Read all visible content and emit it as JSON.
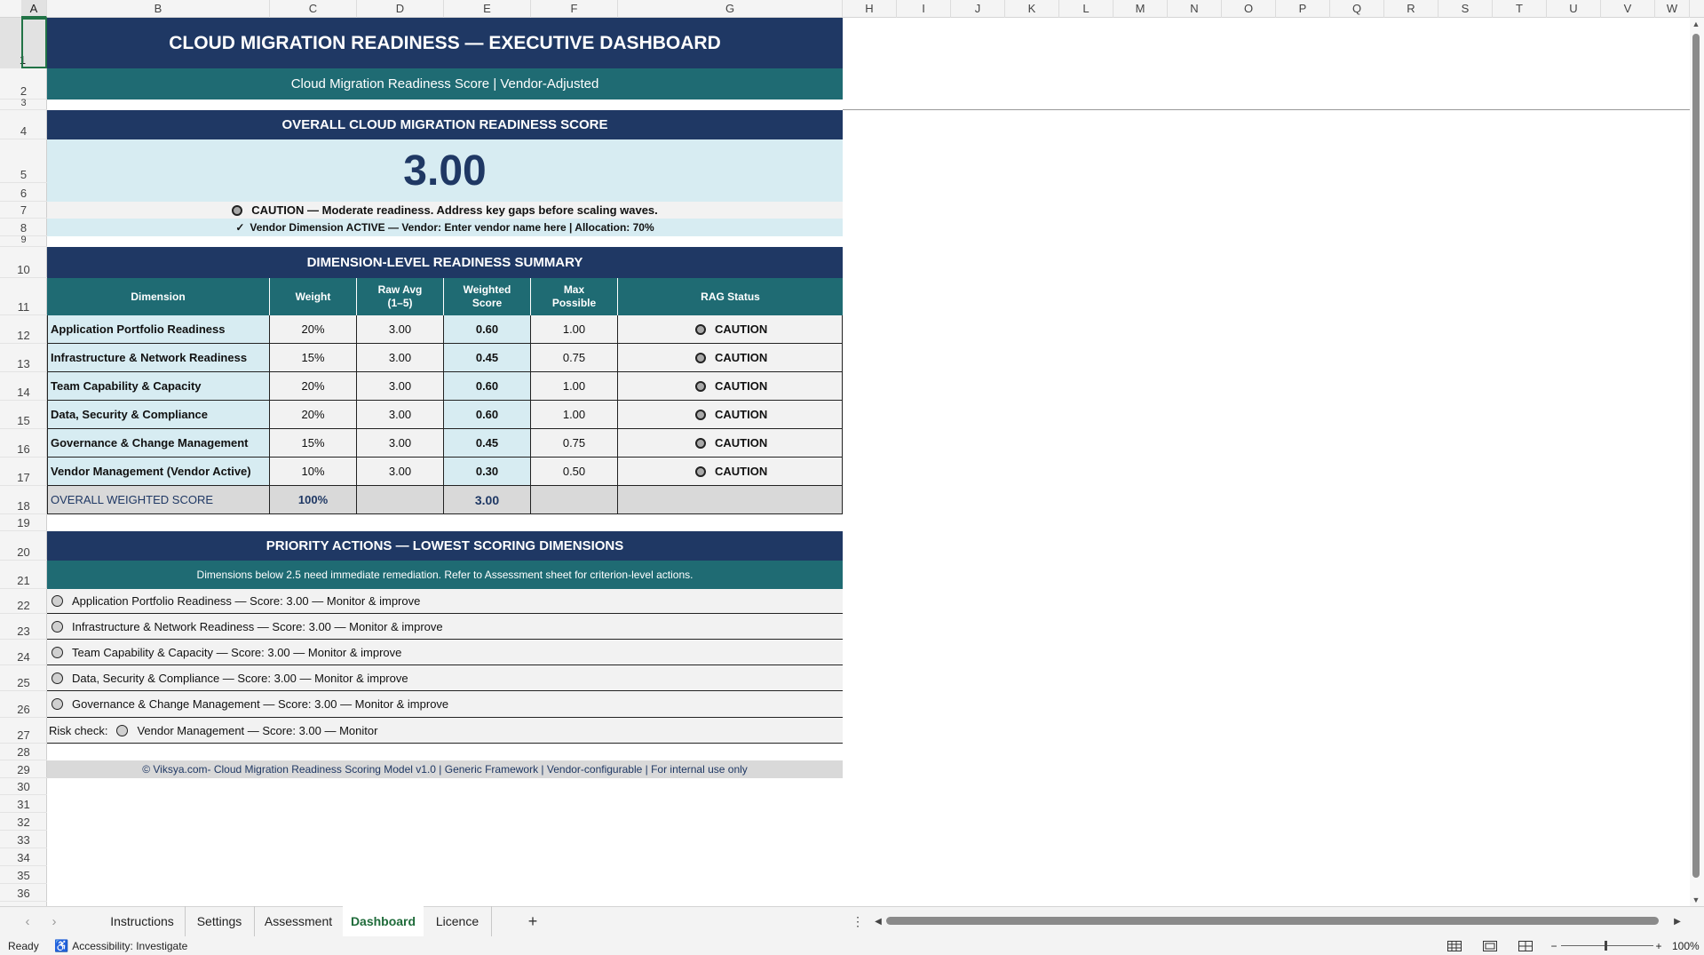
{
  "sheet": {
    "columns": [
      "A",
      "B",
      "C",
      "D",
      "E",
      "F",
      "G",
      "H",
      "I",
      "J",
      "K",
      "L",
      "M",
      "N",
      "O",
      "P",
      "Q",
      "R",
      "S",
      "T",
      "U",
      "V",
      "W"
    ],
    "rows": [
      "1",
      "2",
      "3",
      "4",
      "5",
      "6",
      "7",
      "8",
      "9",
      "10",
      "11",
      "12",
      "13",
      "14",
      "15",
      "16",
      "17",
      "18",
      "19",
      "20",
      "21",
      "22",
      "23",
      "24",
      "25",
      "26",
      "27",
      "28",
      "29",
      "30",
      "31",
      "32",
      "33",
      "34",
      "35",
      "36"
    ],
    "selected_cell": "A1"
  },
  "dashboard": {
    "title": "CLOUD MIGRATION READINESS — EXECUTIVE DASHBOARD",
    "subtitle": "Cloud Migration Readiness Score  |  Vendor-Adjusted",
    "overall_header": "OVERALL CLOUD MIGRATION READINESS SCORE",
    "overall_score": "3.00",
    "caution_text": "CAUTION — Moderate readiness. Address key gaps before scaling waves.",
    "vendor_check": "✓",
    "vendor_text": "Vendor Dimension ACTIVE — Vendor: Enter vendor name here  |  Allocation: 70%",
    "summary_header": "DIMENSION-LEVEL READINESS SUMMARY",
    "table": {
      "headers": {
        "dimension": "Dimension",
        "weight": "Weight",
        "raw_avg": "Raw Avg\n(1–5)",
        "weighted": "Weighted\nScore",
        "max": "Max\nPossible",
        "rag": "RAG Status"
      },
      "rows": [
        {
          "dimension": "Application Portfolio Readiness",
          "weight": "20%",
          "raw": "3.00",
          "weighted": "0.60",
          "max": "1.00",
          "rag": "CAUTION"
        },
        {
          "dimension": "Infrastructure & Network Readiness",
          "weight": "15%",
          "raw": "3.00",
          "weighted": "0.45",
          "max": "0.75",
          "rag": "CAUTION"
        },
        {
          "dimension": "Team Capability & Capacity",
          "weight": "20%",
          "raw": "3.00",
          "weighted": "0.60",
          "max": "1.00",
          "rag": "CAUTION"
        },
        {
          "dimension": "Data, Security & Compliance",
          "weight": "20%",
          "raw": "3.00",
          "weighted": "0.60",
          "max": "1.00",
          "rag": "CAUTION"
        },
        {
          "dimension": "Governance & Change Management",
          "weight": "15%",
          "raw": "3.00",
          "weighted": "0.45",
          "max": "0.75",
          "rag": "CAUTION"
        },
        {
          "dimension": "Vendor Management (Vendor Active)",
          "weight": "10%",
          "raw": "3.00",
          "weighted": "0.30",
          "max": "0.50",
          "rag": "CAUTION"
        }
      ],
      "total": {
        "label": "OVERALL WEIGHTED SCORE",
        "weight": "100%",
        "weighted": "3.00"
      }
    },
    "priority_header": "PRIORITY ACTIONS — LOWEST SCORING DIMENSIONS",
    "priority_note": "Dimensions below 2.5 need immediate remediation. Refer to Assessment sheet for criterion-level actions.",
    "priority_items": [
      "Application Portfolio Readiness — Score: 3.00 — Monitor & improve",
      "Infrastructure & Network Readiness — Score: 3.00 — Monitor & improve",
      "Team Capability & Capacity — Score: 3.00 — Monitor & improve",
      "Data, Security & Compliance — Score: 3.00 — Monitor & improve",
      "Governance & Change Management — Score: 3.00 — Monitor & improve"
    ],
    "risk_label": "Risk check:",
    "risk_text": "Vendor Management — Score: 3.00 — Monitor",
    "footer": "© Viksya.com- Cloud Migration Readiness Scoring Model v1.0  |  Generic Framework  |  Vendor-configurable  |  For internal use only"
  },
  "tabs": [
    {
      "label": "Instructions",
      "active": false
    },
    {
      "label": "Settings",
      "active": false
    },
    {
      "label": "Assessment",
      "active": false
    },
    {
      "label": "Dashboard",
      "active": true
    },
    {
      "label": "Licence",
      "active": false
    }
  ],
  "add_sheet": "+",
  "status": {
    "ready": "Ready",
    "accessibility": "Accessibility: Investigate",
    "zoom": "100%",
    "zoom_minus": "−",
    "zoom_plus": "+"
  },
  "colors": {
    "navy": "#1f3864",
    "teal": "#1f6b73",
    "light_blue": "#d7ecf2",
    "excel_green": "#217346"
  }
}
